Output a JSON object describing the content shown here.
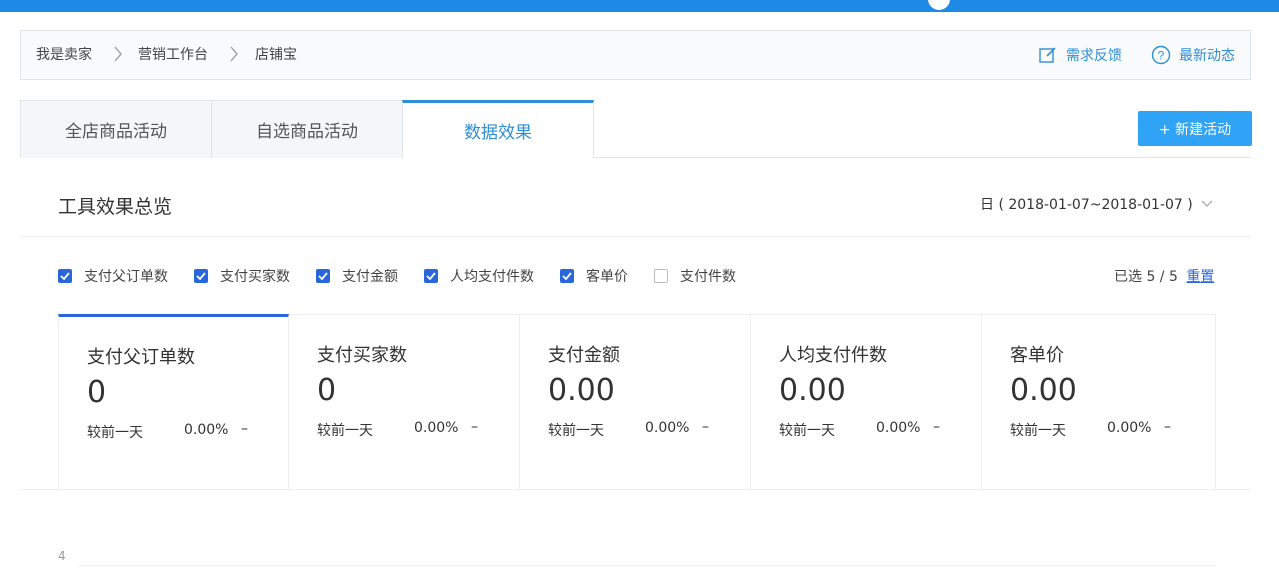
{
  "breadcrumb": {
    "items": [
      "我是卖家",
      "营销工作台",
      "店铺宝"
    ],
    "feedback": "需求反馈",
    "updates": "最新动态"
  },
  "tabs": [
    {
      "label": "全店商品活动",
      "active": false
    },
    {
      "label": "自选商品活动",
      "active": false
    },
    {
      "label": "数据效果",
      "active": true
    }
  ],
  "new_button": "+ 新建活动",
  "overview": {
    "title": "工具效果总览",
    "date_range": "日 ( 2018-01-07~2018-01-07 )"
  },
  "filters": {
    "items": [
      {
        "label": "支付父订单数",
        "checked": true
      },
      {
        "label": "支付买家数",
        "checked": true
      },
      {
        "label": "支付金额",
        "checked": true
      },
      {
        "label": "人均支付件数",
        "checked": true
      },
      {
        "label": "客单价",
        "checked": true
      },
      {
        "label": "支付件数",
        "checked": false
      }
    ],
    "selected_text": "已选 5 / 5",
    "reset": "重置"
  },
  "metrics": [
    {
      "name": "支付父订单数",
      "value": "0",
      "compare_label": "较前一天",
      "change": "0.00%",
      "trend": "–"
    },
    {
      "name": "支付买家数",
      "value": "0",
      "compare_label": "较前一天",
      "change": "0.00%",
      "trend": "–"
    },
    {
      "name": "支付金额",
      "value": "0.00",
      "compare_label": "较前一天",
      "change": "0.00%",
      "trend": "–"
    },
    {
      "name": "人均支付件数",
      "value": "0.00",
      "compare_label": "较前一天",
      "change": "0.00%",
      "trend": "–"
    },
    {
      "name": "客单价",
      "value": "0.00",
      "compare_label": "较前一天",
      "change": "0.00%",
      "trend": "–"
    }
  ],
  "chart": {
    "y_tick": "4"
  },
  "colors": {
    "primary": "#2d8fd5",
    "checkbox": "#2966d9",
    "button": "#2fa3f6",
    "topbar": "#1f8ae6"
  }
}
